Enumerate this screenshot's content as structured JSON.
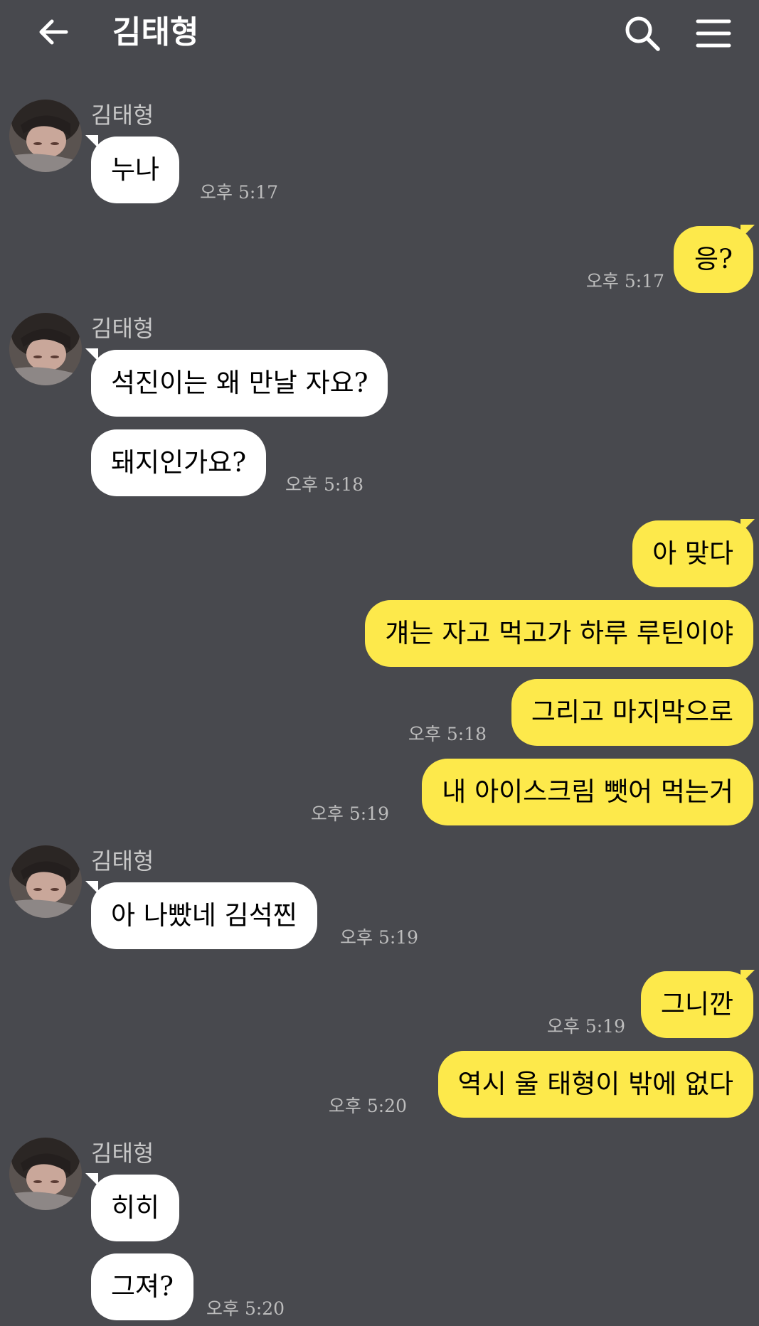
{
  "header": {
    "title": "김태형",
    "back_icon": "arrow-left-icon",
    "search_icon": "search-icon",
    "menu_icon": "hamburger-menu-icon"
  },
  "colors": {
    "background": "#48494e",
    "incoming_bubble": "#ffffff",
    "outgoing_bubble": "#fde94b",
    "timestamp": "#bdbdbd"
  },
  "messages": [
    {
      "sender": "김태형",
      "text": "누나",
      "time": "오후 5:17"
    },
    {
      "text": "응?",
      "time": "오후 5:17"
    },
    {
      "sender": "김태형",
      "text": "석진이는 왜 만날 자요?"
    },
    {
      "text": "돼지인가요?",
      "time": "오후 5:18"
    },
    {
      "text": "아 맞다"
    },
    {
      "text": "걔는 자고 먹고가 하루 루틴이야"
    },
    {
      "text": "그리고 마지막으로",
      "time": "오후 5:18"
    },
    {
      "text": "내 아이스크림 뺏어 먹는거",
      "time": "오후 5:19"
    },
    {
      "sender": "김태형",
      "text": "아 나빴네 김석찐",
      "time": "오후 5:19"
    },
    {
      "text": "그니깐",
      "time": "오후 5:19"
    },
    {
      "text": "역시 울 태형이 밖에 없다",
      "time": "오후 5:20"
    },
    {
      "sender": "김태형",
      "text": "히히"
    },
    {
      "text": "그져?",
      "time": "오후 5:20"
    }
  ]
}
